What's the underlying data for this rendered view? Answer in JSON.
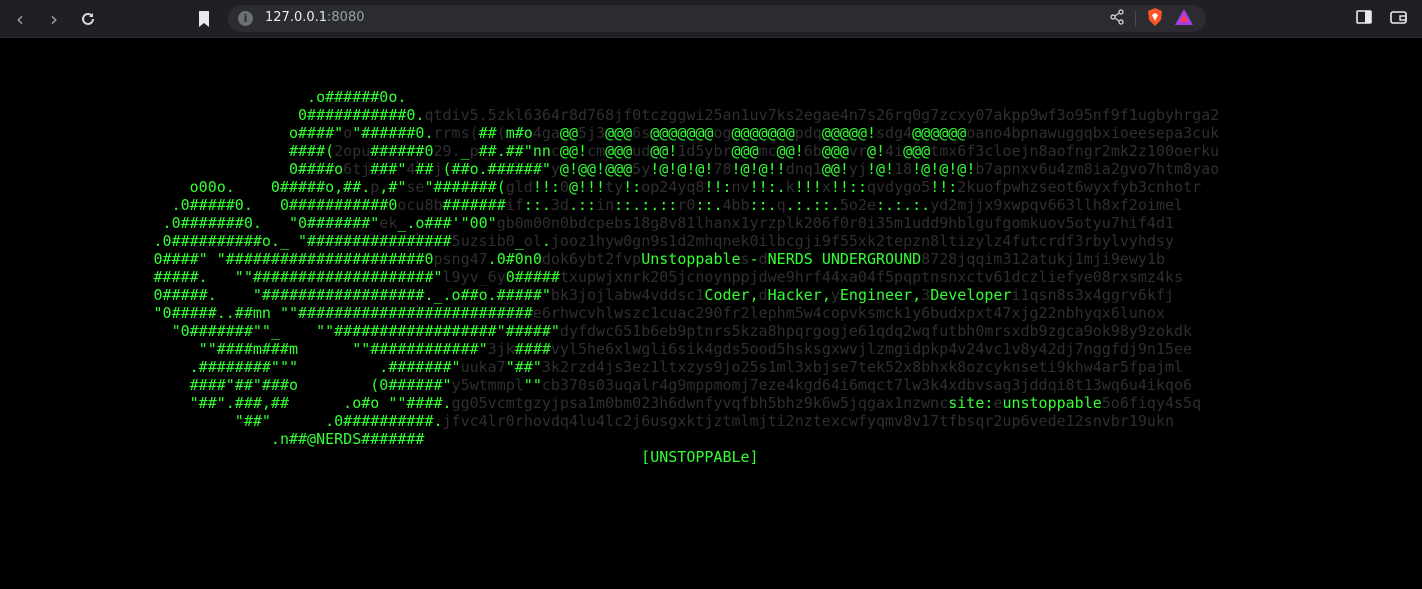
{
  "browser": {
    "url_host": "127.0.0.1",
    "url_port": ":8080",
    "icons": [
      "back-icon",
      "forward-icon",
      "reload-icon",
      "bookmark-icon",
      "site-info-icon",
      "share-icon",
      "brave-shields-icon",
      "brave-rewards-icon",
      "sidebar-icon",
      "wallet-icon"
    ]
  },
  "colors": {
    "background": "#000000",
    "ascii_green": "#33ff33",
    "noise_gray": "#2f2f2f",
    "toolbar": "#1f2023"
  },
  "page": {
    "title_pieces": [
      "Unstoppable",
      "NERDS UNDERGROUND"
    ],
    "roles": [
      "Coder,",
      "Hacker,",
      "Engineer,",
      "Developer"
    ],
    "site_label": "site:",
    "site_value": "unstoppable",
    "signature": ".n##@NERDS#######",
    "footer_tag": "[UNSTOPPABLe]"
  }
}
